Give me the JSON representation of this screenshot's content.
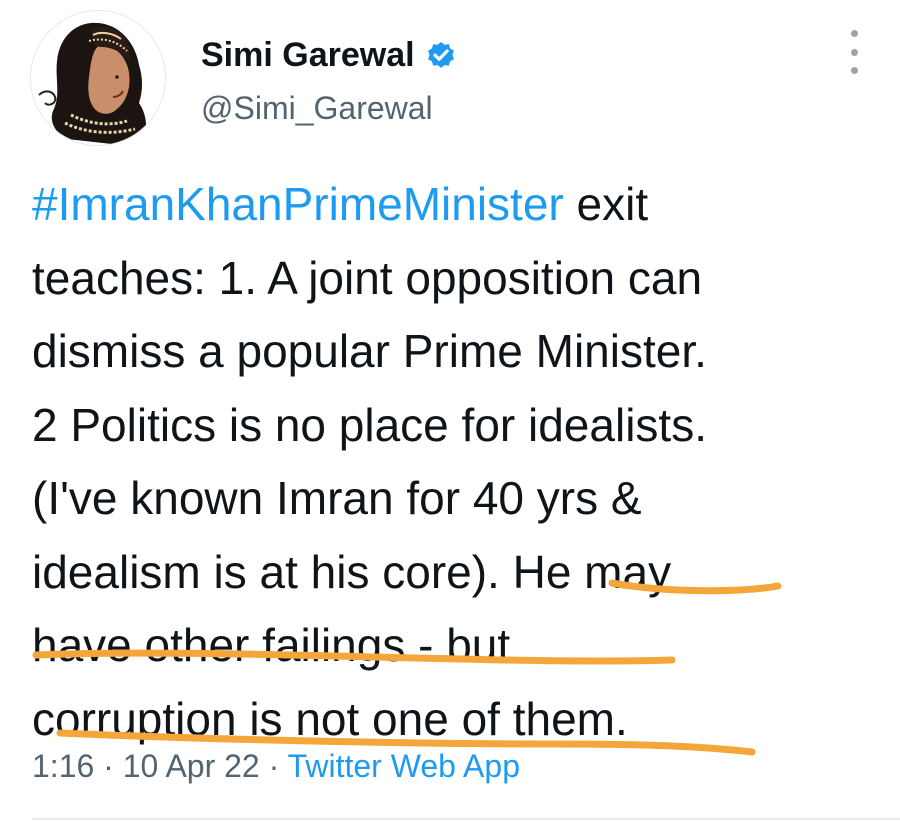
{
  "user": {
    "display_name": "Simi Garewal",
    "handle": "@Simi_Garewal",
    "verified": true,
    "avatar_icon": "profile-illustration"
  },
  "more_icon": "vertical-dots-icon",
  "tweet": {
    "hashtag": "#ImranKhanPrimeMinister",
    "line1_rest": " exit",
    "line2": "teaches: 1. A joint opposition can",
    "line3": "dismiss a popular Prime Minister.",
    "line4": "2 Politics is no place for idealists.",
    "line5": "(I've known Imran for 40 yrs &",
    "line6": "idealism is at his core). He may",
    "line7": "have other failings -  but",
    "line8": "corruption is not one of them."
  },
  "meta": {
    "time": "1:16",
    "sep1": " · ",
    "date": "10 Apr 22",
    "sep2": " · ",
    "source": "Twitter Web App"
  },
  "colors": {
    "hashtag": "#1d9bf0",
    "verified_badge": "#1d9bf0",
    "annotation_underline": "#f5a63a",
    "secondary_text": "#536471"
  }
}
